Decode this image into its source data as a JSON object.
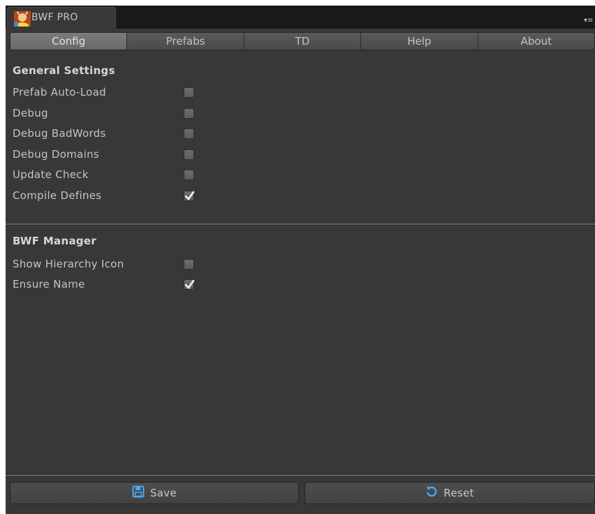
{
  "window": {
    "title": "BWF PRO",
    "icon": "bwf-logo-icon",
    "menu_icon": "tab-menu-icon"
  },
  "tabs": [
    {
      "label": "Config",
      "active": true
    },
    {
      "label": "Prefabs",
      "active": false
    },
    {
      "label": "TD",
      "active": false
    },
    {
      "label": "Help",
      "active": false
    },
    {
      "label": "About",
      "active": false
    }
  ],
  "general_settings": {
    "header": "General Settings",
    "items": [
      {
        "label": "Prefab Auto-Load",
        "checked": false
      },
      {
        "label": "Debug",
        "checked": false
      },
      {
        "label": "Debug BadWords",
        "checked": false
      },
      {
        "label": "Debug Domains",
        "checked": false
      },
      {
        "label": "Update Check",
        "checked": false
      },
      {
        "label": "Compile Defines",
        "checked": true
      }
    ]
  },
  "bwf_manager": {
    "header": "BWF Manager",
    "items": [
      {
        "label": "Show Hierarchy Icon",
        "checked": false
      },
      {
        "label": "Ensure Name",
        "checked": true
      }
    ]
  },
  "footer": {
    "save_label": "Save",
    "save_icon": "floppy-disk-icon",
    "reset_label": "Reset",
    "reset_icon": "reset-arrow-icon"
  },
  "colors": {
    "background": "#383838",
    "icon_blue": "#4aa8f0"
  }
}
